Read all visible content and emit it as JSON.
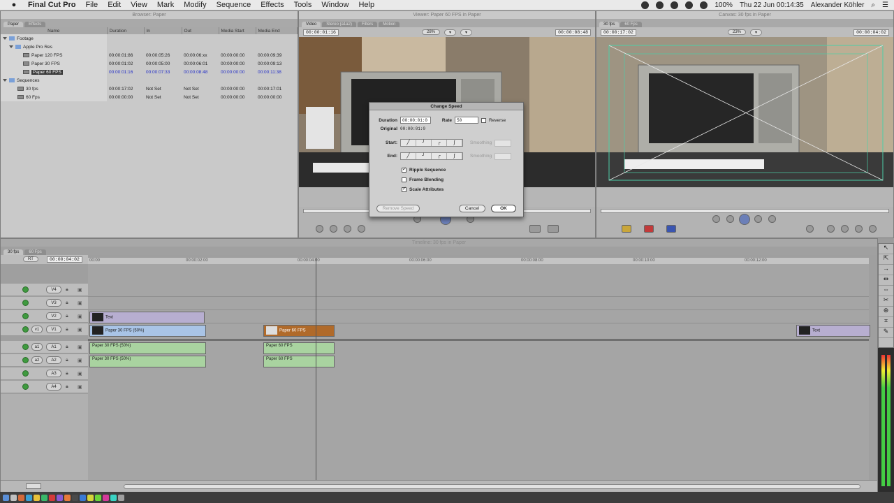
{
  "menubar": {
    "app": "Final Cut Pro",
    "menus": [
      "File",
      "Edit",
      "View",
      "Mark",
      "Modify",
      "Sequence",
      "Effects",
      "Tools",
      "Window",
      "Help"
    ],
    "battery": "100%",
    "clock": "Thu 22 Jun  00:14:35",
    "user": "Alexander Köhler"
  },
  "browser": {
    "title": "Browser: Paper",
    "tabs": [
      "Paper",
      "Effects"
    ],
    "columns": [
      "Name",
      "Duration",
      "In",
      "Out",
      "Media Start",
      "Media End"
    ],
    "rows": [
      {
        "name": "Footage",
        "duration": "",
        "in": "",
        "out": "",
        "start": "",
        "end": ""
      },
      {
        "name": "Apple Pro Res",
        "duration": "",
        "in": "",
        "out": "",
        "start": "",
        "end": ""
      },
      {
        "name": "Paper 120 FPS",
        "duration": "00:00:01:86",
        "in": "00:00:05:26",
        "out": "00:00:06:xx",
        "start": "00:00:00:00",
        "end": "00:00:09:39"
      },
      {
        "name": "Paper 30 FPS",
        "duration": "00:00:01:02",
        "in": "00:00:05:00",
        "out": "00:00:06:01",
        "start": "00:00:00:00",
        "end": "00:00:09:13"
      },
      {
        "name": "Paper 60 FPS",
        "duration": "00:00:01:16",
        "in": "00:00:07:33",
        "out": "00:00:08:48",
        "start": "00:00:00:00",
        "end": "00:00:11:38"
      },
      {
        "name": "Sequences",
        "duration": "",
        "in": "",
        "out": "",
        "start": "",
        "end": ""
      },
      {
        "name": "30 fps",
        "duration": "00:00:17:02",
        "in": "Not Set",
        "out": "Not Set",
        "start": "00:00:00:00",
        "end": "00:00:17:01"
      },
      {
        "name": "60 Fps",
        "duration": "00:00:00:00",
        "in": "Not Set",
        "out": "Not Set",
        "start": "00:00:00:00",
        "end": "00:00:00:00"
      }
    ]
  },
  "viewer": {
    "title": "Viewer: Paper 60 FPS in Paper",
    "tabs": [
      "Video",
      "Stereo (a1a2)",
      "Filters",
      "Motion"
    ],
    "timecode_left": "00:00:01:16",
    "zoom": "28%",
    "timecode_right": "00:00:08:48"
  },
  "canvas": {
    "title": "Canvas: 30 fps in Paper",
    "tabs": [
      "30 fps",
      "60 Fps"
    ],
    "timecode_left": "00:00:17:02",
    "zoom": "23%",
    "timecode_right": "00:00:04:02"
  },
  "dialog": {
    "title": "Change Speed",
    "duration_label": "Duration",
    "duration_value": "00:00:01:0",
    "rate_label": "Rate",
    "rate_value": "50",
    "reverse_label": "Reverse",
    "original_label": "Original",
    "original_value": "00:00:01:0",
    "start_label": "Start:",
    "end_label": "End:",
    "smoothing_label": "Smoothing",
    "ripple_label": "Ripple Sequence",
    "frame_blending_label": "Frame Blending",
    "scale_attributes_label": "Scale Attributes",
    "remove_speed_label": "Remove Speed",
    "cancel_label": "Cancel",
    "ok_label": "OK"
  },
  "timeline": {
    "title": "Timeline: 30 fps in Paper",
    "tabs": [
      "30 fps",
      "60 Fps"
    ],
    "rt": "RT",
    "timecode": "00:00:04:02",
    "ruler": [
      "00:00",
      "00:00:02:00",
      "00:00:04:00",
      "00:00:06:00",
      "00:00:08:00",
      "00:00:10:00",
      "00:00:12:00"
    ],
    "video_tracks": [
      "V4",
      "V3",
      "V2",
      "V1"
    ],
    "audio_tracks": [
      "A1",
      "A2",
      "A3",
      "A4"
    ],
    "source_v": "v1",
    "source_a": [
      "a1",
      "a2"
    ],
    "clips": {
      "text1": "Text",
      "v30": "Paper 30 FPS (50%)",
      "v60": "Paper 60 FPS",
      "text2": "Text",
      "a1_30": "Paper 30 FPS (50%)",
      "a2_30": "Paper 30 FPS (50%)",
      "a1_60": "Paper 60 FPS",
      "a2_60": "Paper 60 FPS"
    }
  },
  "colors": {
    "video_clip": "#a9c4e6",
    "text_clip": "#b7aed0",
    "audio_clip": "#a9d3a0",
    "selected_clip": "#b06a2a",
    "track_enabled": "#3f9a3f"
  }
}
